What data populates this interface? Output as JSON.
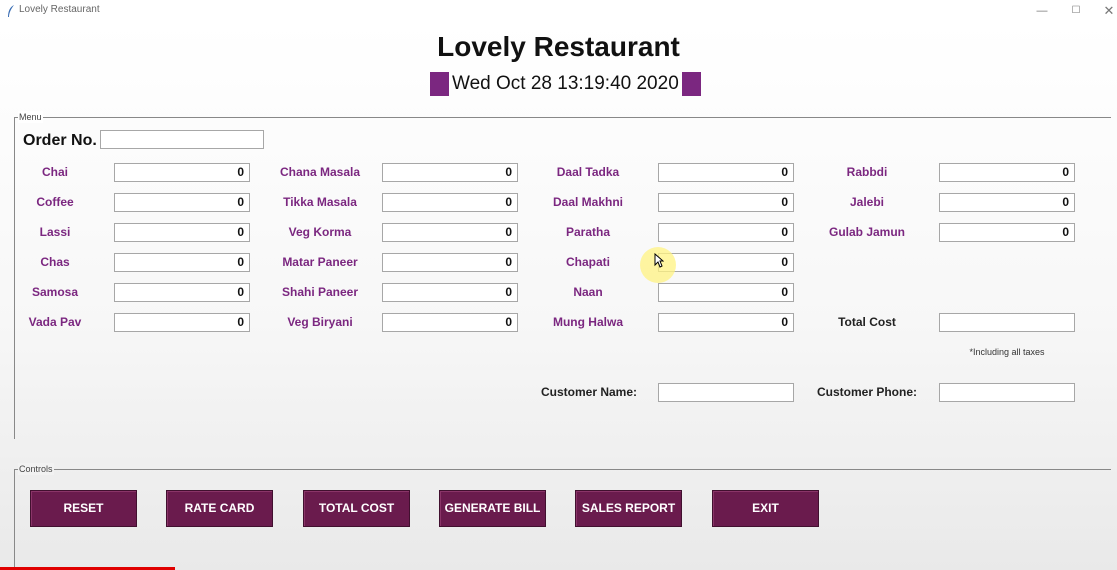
{
  "window": {
    "title": "Lovely Restaurant",
    "minimize": "—",
    "maximize": "☐",
    "close": "✕"
  },
  "header": {
    "title": "Lovely Restaurant",
    "datetime": "Wed Oct 28 13:19:40 2020"
  },
  "menu_frame": {
    "label": "Menu",
    "order_label": "Order No.",
    "order_value": "",
    "items": [
      {
        "label": "Chai",
        "qty": "0"
      },
      {
        "label": "Coffee",
        "qty": "0"
      },
      {
        "label": "Lassi",
        "qty": "0"
      },
      {
        "label": "Chas",
        "qty": "0"
      },
      {
        "label": "Samosa",
        "qty": "0"
      },
      {
        "label": "Vada Pav",
        "qty": "0"
      },
      {
        "label": "Chana Masala",
        "qty": "0"
      },
      {
        "label": "Tikka Masala",
        "qty": "0"
      },
      {
        "label": "Veg Korma",
        "qty": "0"
      },
      {
        "label": "Matar Paneer",
        "qty": "0"
      },
      {
        "label": "Shahi Paneer",
        "qty": "0"
      },
      {
        "label": "Veg Biryani",
        "qty": "0"
      },
      {
        "label": "Daal Tadka",
        "qty": "0"
      },
      {
        "label": "Daal Makhni",
        "qty": "0"
      },
      {
        "label": "Paratha",
        "qty": "0"
      },
      {
        "label": "Chapati",
        "qty": "0"
      },
      {
        "label": "Naan",
        "qty": "0"
      },
      {
        "label": "Mung Halwa",
        "qty": "0"
      },
      {
        "label": "Rabbdi",
        "qty": "0"
      },
      {
        "label": "Jalebi",
        "qty": "0"
      },
      {
        "label": "Gulab Jamun",
        "qty": "0"
      }
    ],
    "total_cost_label": "Total Cost",
    "total_cost_value": "",
    "tax_note": "*Including all taxes",
    "customer_name_label": "Customer Name:",
    "customer_name_value": "",
    "customer_phone_label": "Customer Phone:",
    "customer_phone_value": ""
  },
  "controls_frame": {
    "label": "Controls",
    "buttons": [
      "RESET",
      "RATE CARD",
      "TOTAL COST",
      "GENERATE BILL",
      "SALES REPORT",
      "EXIT"
    ]
  },
  "colors": {
    "accent": "#7b2780",
    "button": "#6a1b4d"
  }
}
